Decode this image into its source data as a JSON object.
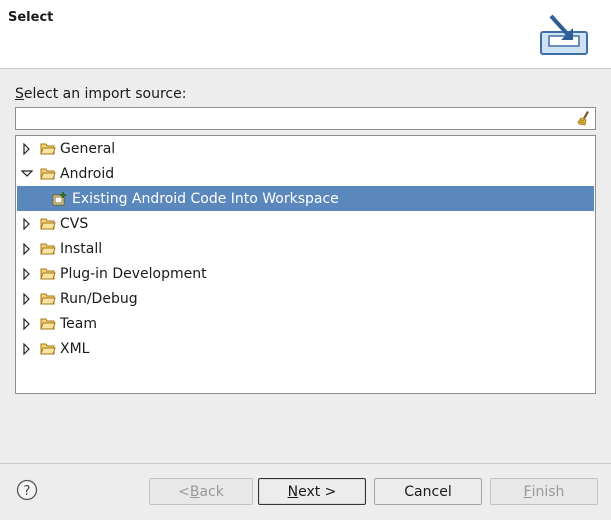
{
  "header": {
    "title": "Select"
  },
  "source": {
    "label_mnemonic": "S",
    "label_rest": "elect an import source:",
    "filter_value": ""
  },
  "tree": {
    "items": [
      {
        "label": "General",
        "expanded": false,
        "level": 0,
        "selected": false
      },
      {
        "label": "Android",
        "expanded": true,
        "level": 0,
        "selected": false
      },
      {
        "label": "Existing Android Code Into Workspace",
        "level": 1,
        "selected": true
      },
      {
        "label": "CVS",
        "expanded": false,
        "level": 0,
        "selected": false
      },
      {
        "label": "Install",
        "expanded": false,
        "level": 0,
        "selected": false
      },
      {
        "label": "Plug-in Development",
        "expanded": false,
        "level": 0,
        "selected": false
      },
      {
        "label": "Run/Debug",
        "expanded": false,
        "level": 0,
        "selected": false
      },
      {
        "label": "Team",
        "expanded": false,
        "level": 0,
        "selected": false
      },
      {
        "label": "XML",
        "expanded": false,
        "level": 0,
        "selected": false
      }
    ]
  },
  "buttons": {
    "back_mnemonic": "B",
    "back_rest": "ack",
    "back_prefix": "< ",
    "next_mnemonic": "N",
    "next_rest": "ext >",
    "cancel": "Cancel",
    "finish_mnemonic": "F",
    "finish_rest": "inish"
  },
  "colors": {
    "selection": "#5b88bc",
    "folder": "#e8b04a"
  }
}
